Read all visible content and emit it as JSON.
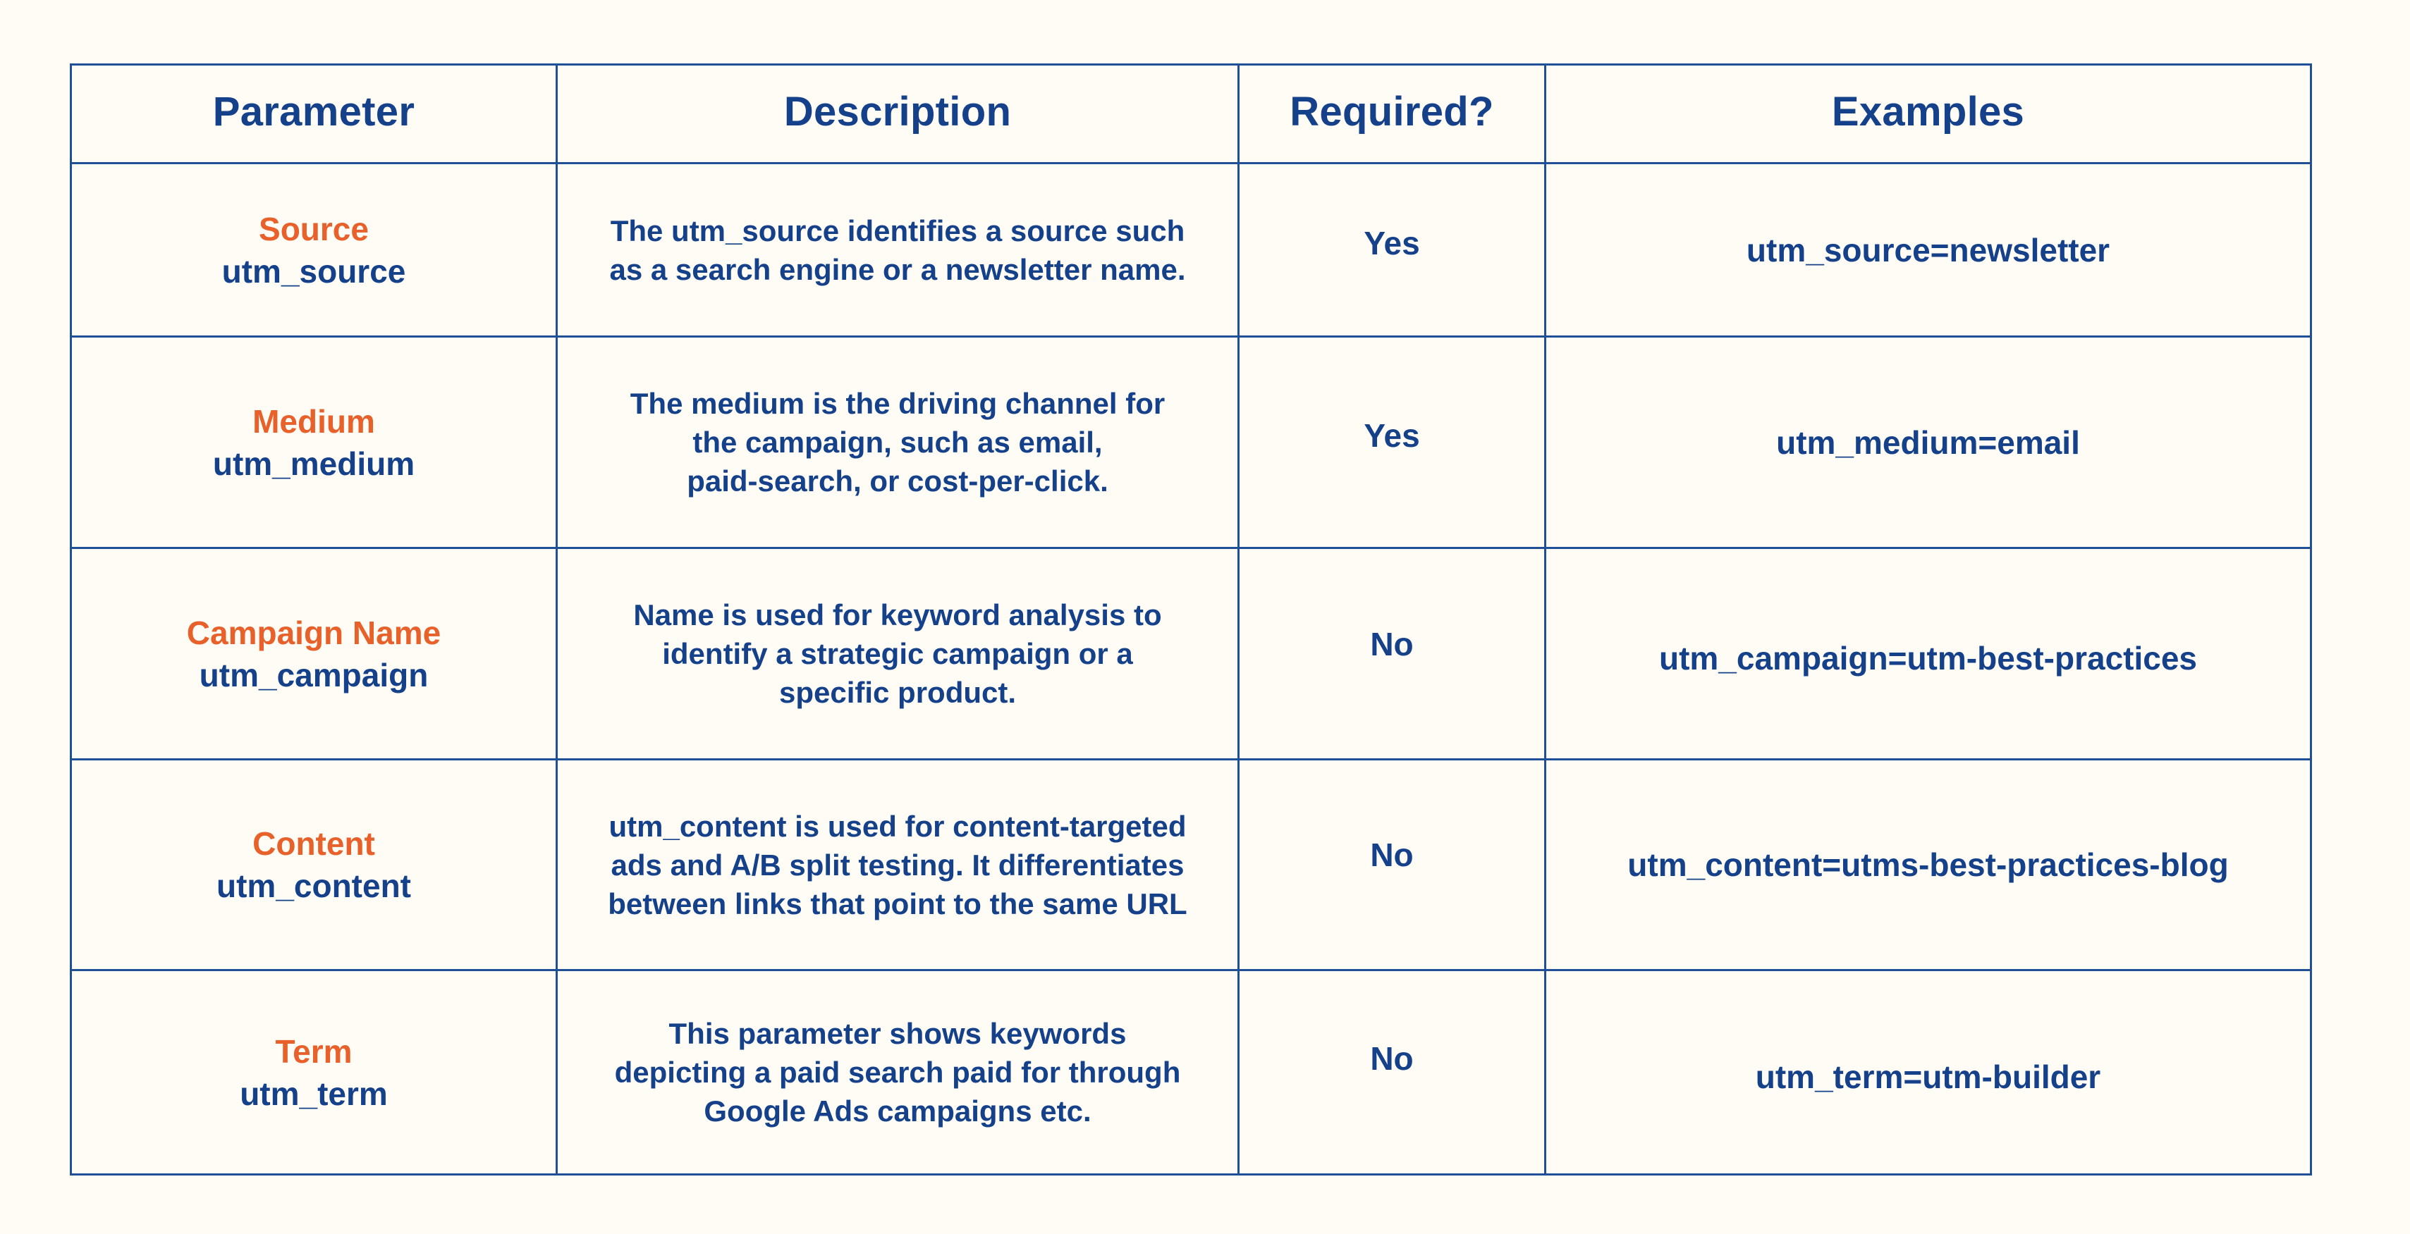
{
  "table": {
    "headers": [
      "Parameter",
      "Description",
      "Required?",
      "Examples"
    ],
    "rows": [
      {
        "name": "Source",
        "code": "utm_source",
        "description": "The utm_source identifies a source such\nas a search engine or a newsletter name.",
        "required": "Yes",
        "example": "utm_source=newsletter"
      },
      {
        "name": "Medium",
        "code": "utm_medium",
        "description": "The medium is the driving channel for\nthe campaign, such as email,\npaid-search, or cost-per-click.",
        "required": "Yes",
        "example": "utm_medium=email"
      },
      {
        "name": "Campaign Name",
        "code": "utm_campaign",
        "description": "Name is used for keyword analysis to\nidentify a strategic campaign or a\nspecific product.",
        "required": "No",
        "example": "utm_campaign=utm-best-practices"
      },
      {
        "name": "Content",
        "code": "utm_content",
        "description": "utm_content is used for content-targeted\nads and A/B split testing. It differentiates\nbetween links that point to the same URL",
        "required": "No",
        "example": "utm_content=utms-best-practices-blog"
      },
      {
        "name": "Term",
        "code": "utm_term",
        "description": "This parameter shows keywords\ndepicting a paid search paid for through\nGoogle Ads campaigns etc.",
        "required": "No",
        "example": "utm_term=utm-builder"
      }
    ]
  },
  "colors": {
    "background": "#fffcf5",
    "text_primary": "#15418b",
    "accent": "#e8602a",
    "border": "#1f4f96"
  }
}
